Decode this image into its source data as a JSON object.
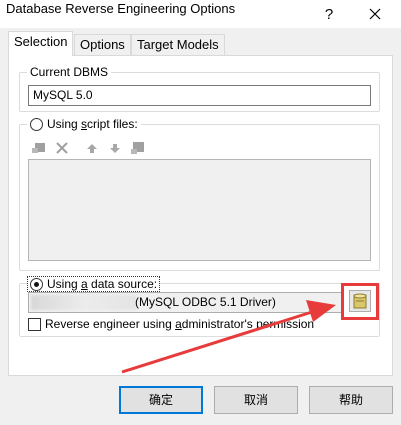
{
  "window": {
    "title": "Database Reverse Engineering Options",
    "help_label": "?"
  },
  "tabs": [
    {
      "label": "Selection",
      "active": true
    },
    {
      "label": "Options",
      "active": false
    },
    {
      "label": "Target Models",
      "active": false
    }
  ],
  "current_dbms": {
    "legend": "Current DBMS",
    "value": "MySQL 5.0"
  },
  "script_files": {
    "legend_prefix": "Using ",
    "legend_accel": "s",
    "legend_suffix": "cript files:",
    "selected": false,
    "toolbar_icons": [
      "add-file-icon",
      "delete-icon",
      "move-up-icon",
      "move-down-icon",
      "save-icon"
    ]
  },
  "data_source": {
    "legend_prefix": "Using ",
    "legend_accel": "a",
    "legend_suffix": " data source:",
    "selected": true,
    "value_visible": "(MySQL ODBC 5.1 Driver)",
    "browse_icon": "database-icon"
  },
  "admin_permission": {
    "label_prefix": "Reverse engineer using ",
    "label_accel": "a",
    "label_suffix": "dministrator's permission",
    "checked": false
  },
  "buttons": {
    "ok": "确定",
    "cancel": "取消",
    "help": "帮助"
  },
  "colors": {
    "highlight": "#e83c3c",
    "default_button_border": "#0078d7"
  }
}
